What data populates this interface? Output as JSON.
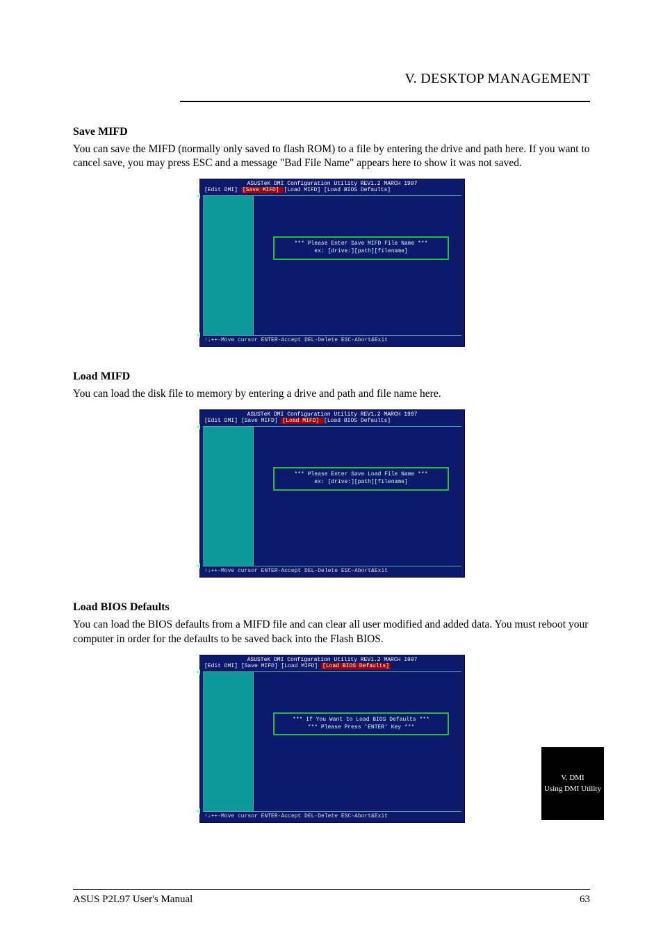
{
  "header": {
    "title": "V. DESKTOP MANAGEMENT"
  },
  "save_section": {
    "title": "Save MIFD",
    "body": "You can save the MIFD (normally only saved to flash ROM) to a file by entering the drive and path here. If you want to cancel save, you may press ESC and a message \"Bad File Name\" appears here to show it was not saved."
  },
  "load_section": {
    "title": "Load MIFD",
    "body": "You can load the disk file to memory by entering a drive and path and file name here."
  },
  "defaults_section": {
    "title": "Load BIOS Defaults",
    "body": "You can load the BIOS defaults from a MIFD file and can clear all user modified and added data. You must reboot your computer in order for the defaults to be saved back into the Flash BIOS."
  },
  "bios_common": {
    "title_line": "ASUSTeK DMI Configuration Utility  REV1.2   MARCH 1997",
    "menubar_pre": "[Edit DMI] ",
    "menubar_save": "[Save MIFD] ",
    "menubar_load": "[Load MIFD] ",
    "menubar_defaults": "[Load BIOS Defaults]",
    "hint": "↑↓++-Move cursor  ENTER-Accept  DEL-Delete  ESC-Abort&Exit"
  },
  "bios1": {
    "prompt_l1": "*** Please Enter Save MIFD File Name ***",
    "prompt_l2": "ex: [drive:][path][filename]"
  },
  "bios2": {
    "prompt_l1": "*** Please Enter Save Load File Name ***",
    "prompt_l2": "ex: [drive:][path][filename]"
  },
  "bios3": {
    "prompt_l1": "*** If You Want to Load BIOS Defaults ***",
    "prompt_l2": "*** Please Press 'ENTER' Key ***"
  },
  "side_tab": {
    "line1": "V. DMI",
    "line2": "Using DMI Utility"
  },
  "footer": {
    "left": "ASUS P2L97 User's Manual",
    "right": "63"
  }
}
